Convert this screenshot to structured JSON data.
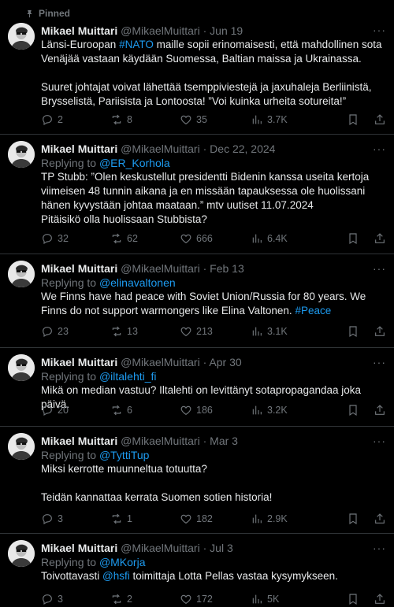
{
  "pinned_label": "Pinned",
  "tweets": [
    {
      "name": "Mikael Muittari",
      "handle": "@MikaelMuittari",
      "date": "Jun 19",
      "replying_prefix": "",
      "replying_to": "",
      "line1a": "Länsi-Euroopan ",
      "line1_tag": "#NATO",
      "line1b": " maille sopii erinomaisesti, että mahdollinen sota Venäjää vastaan käydään Suomessa, Baltian maissa ja Ukrainassa.\n\nSuuret johtajat voivat lähettää tsemppiviestejä ja jaxuhaleja Berliinistä, Brysselistä, Pariisista ja Lontoosta! ”Voi kuinka urheita sotureita!”",
      "replies": "2",
      "retweets": "8",
      "likes": "35",
      "views": "3.7K"
    },
    {
      "name": "Mikael Muittari",
      "handle": "@MikaelMuittari",
      "date": "Dec 22, 2024",
      "replying_prefix": "Replying to ",
      "replying_to": "@ER_Korhola",
      "text": "TP Stubb: ”Olen keskustellut presidentti Bidenin kanssa useita kertoja viimeisen 48 tunnin aikana ja en missään tapauksessa ole huolissani hänen kyvystään johtaa maataan.” mtv uutiset 11.07.2024\nPitäisikö olla huolissaan Stubbista?",
      "replies": "32",
      "retweets": "62",
      "likes": "666",
      "views": "6.4K"
    },
    {
      "name": "Mikael Muittari",
      "handle": "@MikaelMuittari",
      "date": "Feb 13",
      "replying_prefix": "Replying to ",
      "replying_to": "@elinavaltonen",
      "text": "We Finns have had peace with Soviet Union/Russia for 80 years. We Finns do not support warmongers like Elina Valtonen. ",
      "tag": "#Peace",
      "replies": "23",
      "retweets": "13",
      "likes": "213",
      "views": "3.1K"
    },
    {
      "name": "Mikael Muittari",
      "handle": "@MikaelMuittari",
      "date": "Apr 30",
      "replying_prefix": "Replying to ",
      "replying_to": "@iltalehti_fi",
      "text": "Mikä on median vastuu? Iltalehti on levittänyt sotapropagandaa joka päivä.",
      "replies": "20",
      "retweets": "6",
      "likes": "186",
      "views": "3.2K"
    },
    {
      "name": "Mikael Muittari",
      "handle": "@MikaelMuittari",
      "date": "Mar 3",
      "replying_prefix": "Replying to ",
      "replying_to": "@TyttiTup",
      "text": "Miksi kerrotte muunneltua totuutta?\n\nTeidän kannattaa kerrata Suomen sotien historia!",
      "replies": "3",
      "retweets": "1",
      "likes": "182",
      "views": "2.9K"
    },
    {
      "name": "Mikael Muittari",
      "handle": "@MikaelMuittari",
      "date": "Jul 3",
      "replying_prefix": "Replying to ",
      "replying_to": "@MKorja",
      "text_a": "Toivottavasti ",
      "mention": "@hsfi",
      "text_b": " toimittaja Lotta Pellas vastaa kysymykseen.",
      "replies": "3",
      "retweets": "2",
      "likes": "172",
      "views": "5K"
    }
  ],
  "more_glyph": "···",
  "separator": "·"
}
